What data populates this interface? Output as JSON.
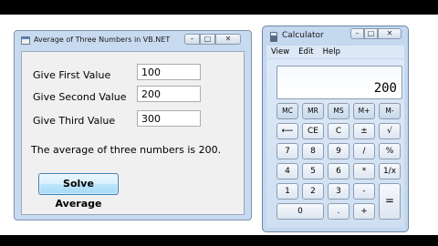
{
  "average_window": {
    "title": "Average of Three Numbers in VB.NET",
    "caption_buttons": {
      "minimize": "–",
      "maximize": "□",
      "close": "✕"
    },
    "first_label": "Give First Value",
    "first_value": "100",
    "second_label": "Give Second Value",
    "second_value": "200",
    "third_label": "Give Third Value",
    "third_value": "300",
    "result_text": "The average of three numbers is 200.",
    "solve_button": "Solve Average"
  },
  "calculator": {
    "title": "Calculator",
    "caption_buttons": {
      "minimize": "–",
      "maximize": "□",
      "close": "✕"
    },
    "menu": [
      "View",
      "Edit",
      "Help"
    ],
    "display_value": "200",
    "keys": {
      "mc": "MC",
      "mr": "MR",
      "ms": "MS",
      "mplus": "M+",
      "mminus": "M-",
      "backspace": "⟵",
      "ce": "CE",
      "c": "C",
      "plusminus": "±",
      "sqrt": "√",
      "k7": "7",
      "k8": "8",
      "k9": "9",
      "divide": "/",
      "percent": "%",
      "k4": "4",
      "k5": "5",
      "k6": "6",
      "multiply": "*",
      "reciprocal": "1/x",
      "k1": "1",
      "k2": "2",
      "k3": "3",
      "minus": "-",
      "equals": "=",
      "k0": "0",
      "decimal": ".",
      "plus": "+"
    }
  }
}
